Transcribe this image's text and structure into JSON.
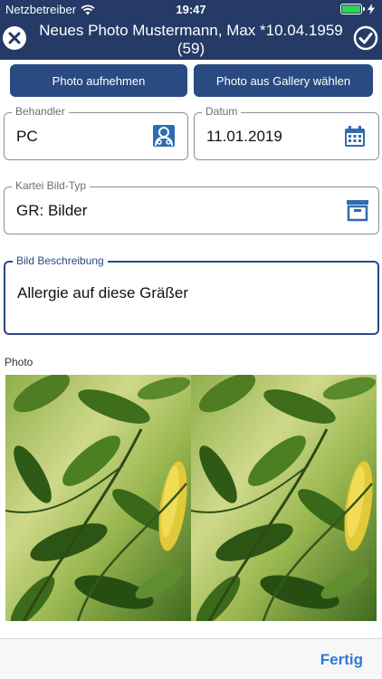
{
  "status_bar": {
    "carrier": "Netzbetreiber",
    "time": "19:47",
    "wifi_icon": "wifi-icon",
    "battery_icon": "battery-icon",
    "charging_icon": "charging-bolt-icon"
  },
  "nav": {
    "title": "Neues Photo Mustermann, Max *10.04.1959 (59)",
    "close_icon": "close-circle-icon",
    "confirm_icon": "checkmark-circle-icon"
  },
  "buttons": {
    "take_photo": "Photo aufnehmen",
    "choose_gallery": "Photo aus Gallery wählen"
  },
  "fields": {
    "behandler": {
      "label": "Behandler",
      "value": "PC",
      "icon": "person-card-icon"
    },
    "datum": {
      "label": "Datum",
      "value": "11.01.2019",
      "icon": "calendar-icon"
    },
    "kartei_bild_typ": {
      "label": "Kartei Bild-Typ",
      "value": "GR: Bilder",
      "icon": "archive-box-icon"
    },
    "bild_beschreibung": {
      "label": "Bild Beschreibung",
      "value": "Allergie auf diese Gräßer"
    }
  },
  "photo": {
    "label": "Photo"
  },
  "footer": {
    "done_label": "Fertig"
  },
  "colors": {
    "header_bg": "#253a66",
    "button_bg": "#2a4a82",
    "accent_link": "#2f79d8",
    "battery_green": "#2fd158"
  }
}
